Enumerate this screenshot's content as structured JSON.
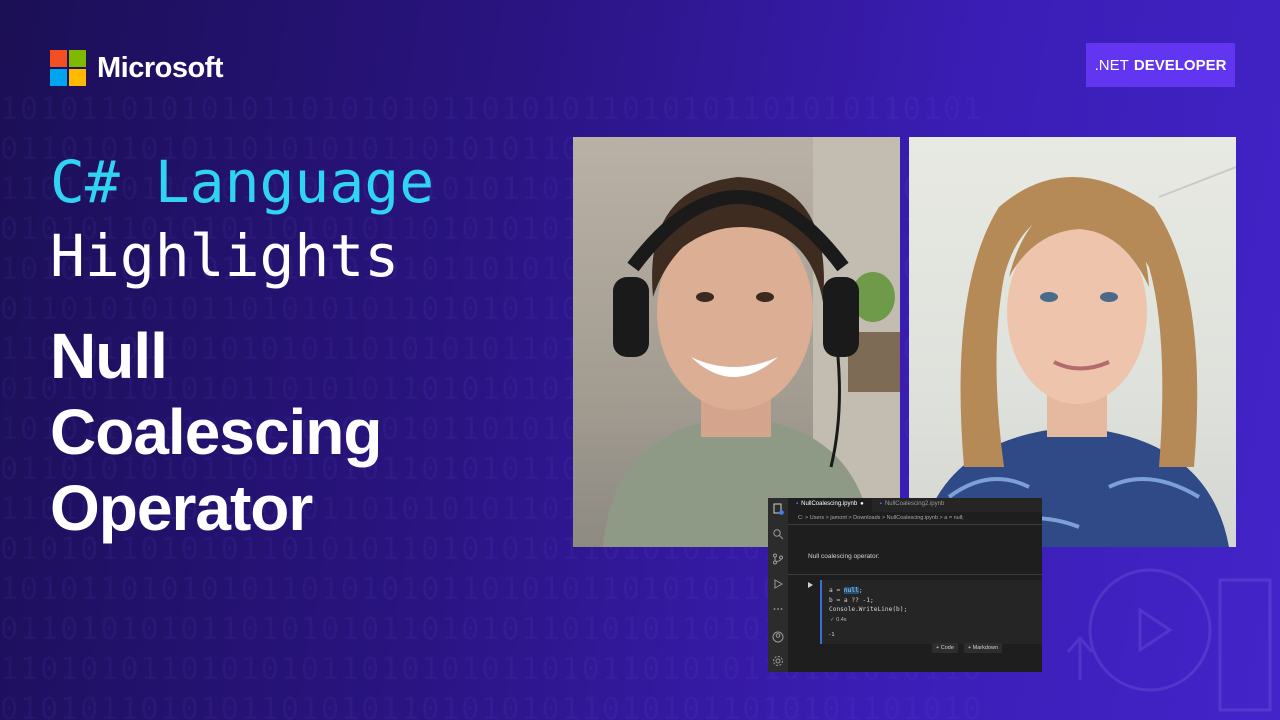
{
  "brand": {
    "name": "Microsoft",
    "colors": [
      "#f25022",
      "#7fba00",
      "#00a4ef",
      "#ffb900"
    ]
  },
  "badge": {
    "prefix": ".NET",
    "label": "DEVELOPER"
  },
  "series": {
    "line1": "C# Language",
    "line2": "Highlights"
  },
  "topic": {
    "lines": [
      "Null",
      "Coalescing",
      "Operator"
    ]
  },
  "participants": [
    {
      "name": "host-with-headphones"
    },
    {
      "name": "guest"
    }
  ],
  "editor": {
    "tabs": [
      {
        "label": "NullCoalescing.ipynb",
        "modified": "●"
      },
      {
        "label": "NullCoalescing2.ipynb"
      }
    ],
    "breadcrumb": "C: > Users > jamont > Downloads > NullCoalescing.ipynb > a = null;",
    "markdown": "Null coalescing operator:",
    "code": {
      "line1_prefix": "a = ",
      "line1_highlight": "null",
      "line1_suffix": ";",
      "line2": "b = a ?? -1;",
      "line3": "Console.WriteLine(b);"
    },
    "timing": "0.4s",
    "output": "-1",
    "add_code": "+ Code",
    "add_markdown": "+ Markdown",
    "activity_icons": [
      "files-icon",
      "search-icon",
      "source-control-icon",
      "run-debug-icon",
      "more-icon",
      "account-icon",
      "settings-icon"
    ]
  }
}
